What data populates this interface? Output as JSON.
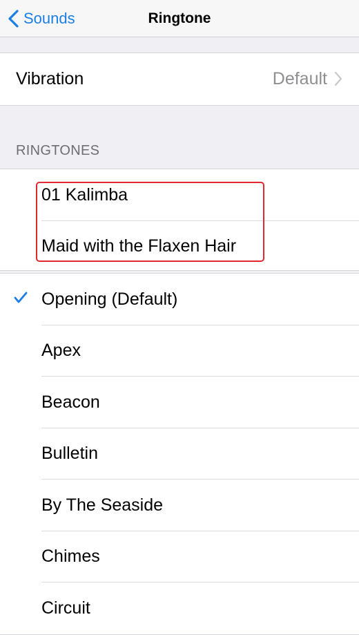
{
  "navbar": {
    "back_label": "Sounds",
    "title": "Ringtone"
  },
  "vibration": {
    "label": "Vibration",
    "value": "Default"
  },
  "section_header": "RINGTONES",
  "custom_ringtones": [
    {
      "label": "01 Kalimba"
    },
    {
      "label": "Maid with the Flaxen Hair"
    }
  ],
  "ringtones": [
    {
      "label": "Opening (Default)",
      "selected": true
    },
    {
      "label": "Apex"
    },
    {
      "label": "Beacon"
    },
    {
      "label": "Bulletin"
    },
    {
      "label": "By The Seaside"
    },
    {
      "label": "Chimes"
    },
    {
      "label": "Circuit"
    }
  ],
  "colors": {
    "accent": "#1a7ee6",
    "highlight": "#e0282e",
    "secondary_text": "#8e8e93",
    "background": "#efeff4"
  }
}
